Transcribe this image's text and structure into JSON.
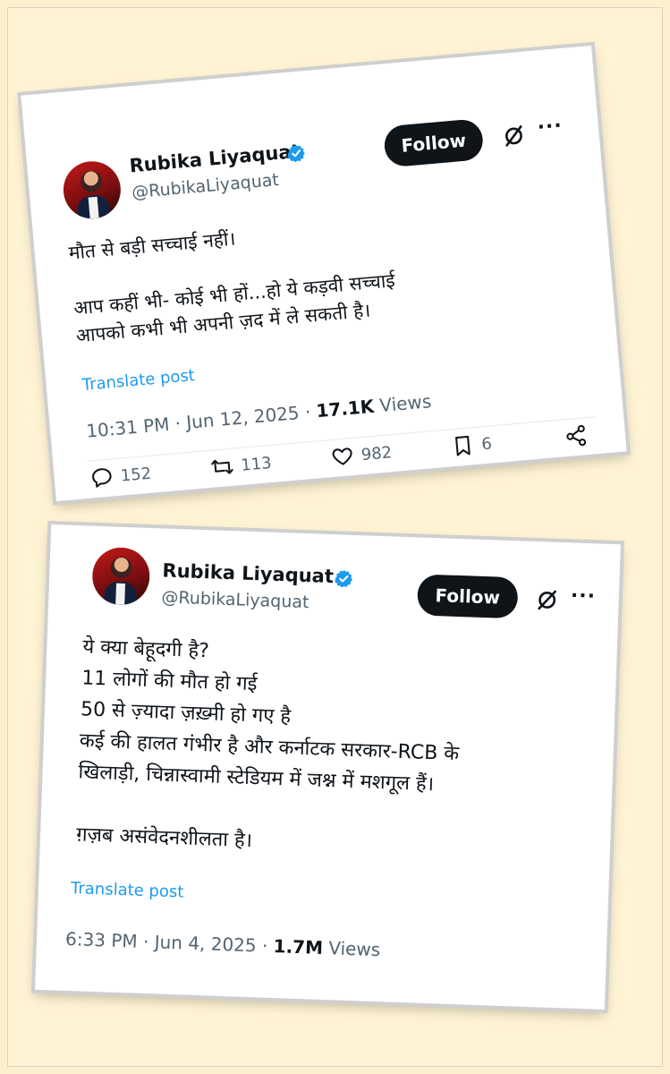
{
  "tweets": [
    {
      "author": {
        "name": "Rubika Liyaquat",
        "handle": "@RubikaLiyaquat"
      },
      "follow_label": "Follow",
      "lines": [
        "मौत से बड़ी सच्चाई नहीं।",
        "",
        "आप कहीं भी- कोई भी हों...हो ये कड़वी सच्चाई",
        "आपको कभी भी अपनी ज़द में ले सकती है।"
      ],
      "translate_label": "Translate post",
      "time": "10:31 PM · Jun 12, 2025 · ",
      "views_count": "17.1K",
      "views_label": " Views",
      "actions": {
        "replies": "152",
        "reposts": "113",
        "likes": "982",
        "bookmarks": "6"
      }
    },
    {
      "author": {
        "name": "Rubika Liyaquat",
        "handle": "@RubikaLiyaquat"
      },
      "follow_label": "Follow",
      "lines": [
        "ये क्या बेहूदगी है?",
        "11 लोगों की मौत हो गई",
        "50 से ज़्यादा ज़ख़्मी हो गए है",
        "कई की हालत गंभीर है और कर्नाटक सरकार-RCB के",
        "खिलाड़ी, चिन्नास्वामी स्टेडियम में जश्न में मशगूल हैं।",
        "",
        "ग़ज़ब असंवेदनशीलता है।"
      ],
      "translate_label": "Translate post",
      "time": "6:33 PM · Jun 4, 2025 · ",
      "views_count": "1.7M",
      "views_label": " Views"
    }
  ],
  "colors": {
    "link": "#1d9bf0",
    "secondary": "#536471",
    "verified": "#1d9bf0",
    "follow_bg": "#0f1419"
  }
}
